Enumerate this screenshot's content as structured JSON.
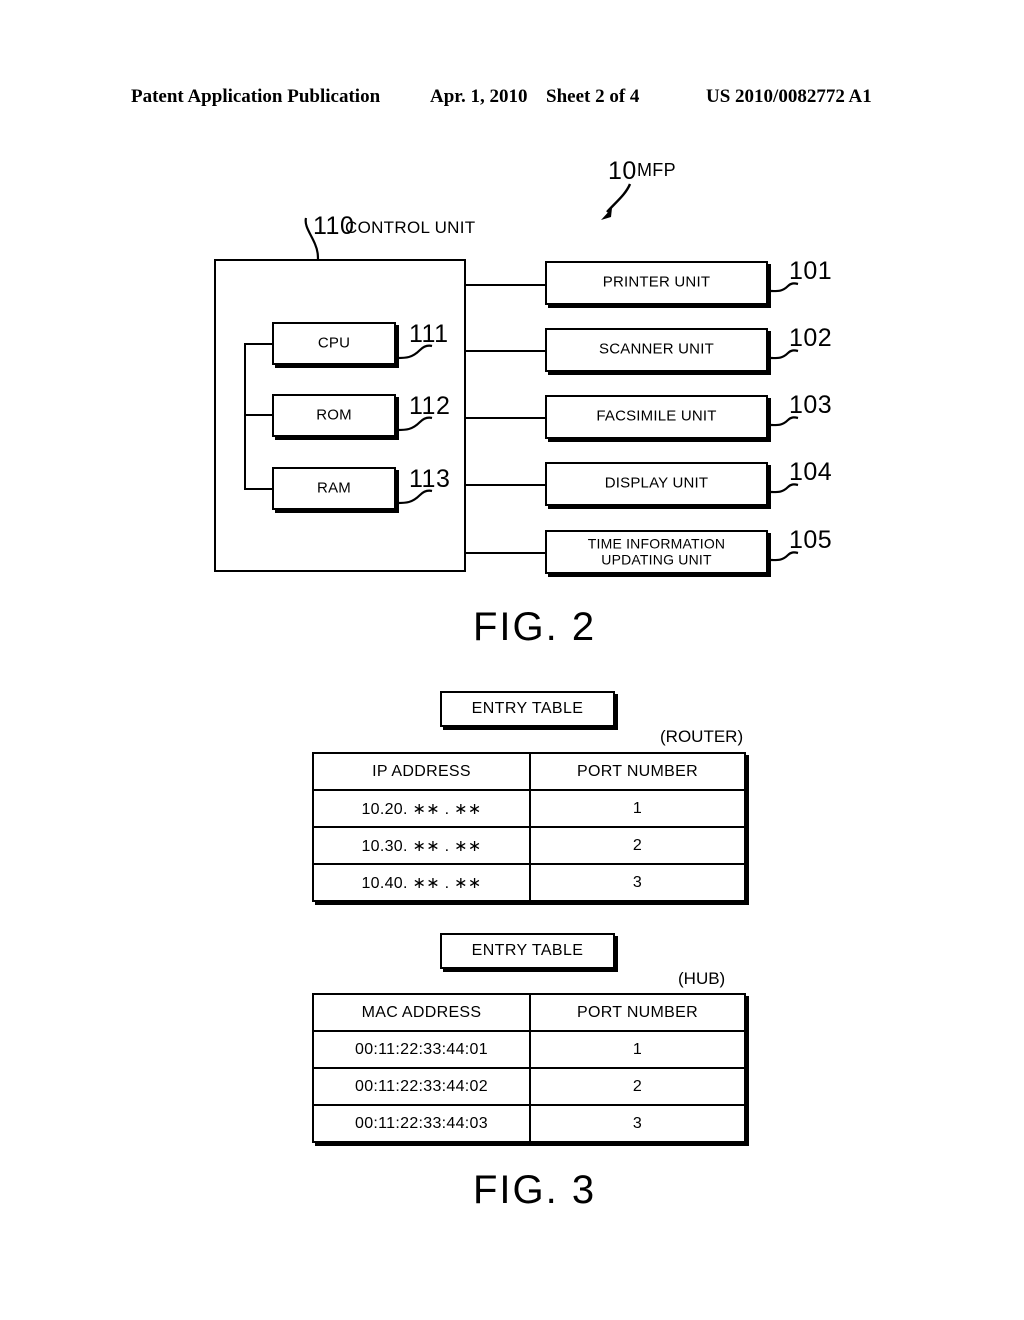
{
  "header": {
    "publication": "Patent Application Publication",
    "date": "Apr. 1, 2010",
    "sheet": "Sheet 2 of 4",
    "patent_number": "US 2010/0082772 A1"
  },
  "figure2": {
    "caption": "FIG. 2",
    "device_ref": "10",
    "device_label": "MFP",
    "control_unit_ref": "110",
    "control_unit_label": "CONTROL UNIT",
    "internal_blocks": [
      {
        "label": "CPU",
        "ref": "111"
      },
      {
        "label": "ROM",
        "ref": "112"
      },
      {
        "label": "RAM",
        "ref": "113"
      }
    ],
    "peripheral_units": [
      {
        "label": "PRINTER UNIT",
        "ref": "101"
      },
      {
        "label": "SCANNER UNIT",
        "ref": "102"
      },
      {
        "label": "FACSIMILE UNIT",
        "ref": "103"
      },
      {
        "label": "DISPLAY UNIT",
        "ref": "104"
      },
      {
        "label": "TIME INFORMATION UPDATING UNIT",
        "ref": "105"
      }
    ]
  },
  "figure3": {
    "caption": "FIG. 3",
    "router_table": {
      "title": "ENTRY TABLE",
      "device": "(ROUTER)",
      "columns": [
        "IP ADDRESS",
        "PORT NUMBER"
      ],
      "rows": [
        [
          "10.20. ∗∗ . ∗∗",
          "1"
        ],
        [
          "10.30. ∗∗ . ∗∗",
          "2"
        ],
        [
          "10.40. ∗∗ . ∗∗",
          "3"
        ]
      ]
    },
    "hub_table": {
      "title": "ENTRY TABLE",
      "device": "(HUB)",
      "columns": [
        "MAC ADDRESS",
        "PORT NUMBER"
      ],
      "rows": [
        [
          "00:11:22:33:44:01",
          "1"
        ],
        [
          "00:11:22:33:44:02",
          "2"
        ],
        [
          "00:11:22:33:44:03",
          "3"
        ]
      ]
    }
  }
}
